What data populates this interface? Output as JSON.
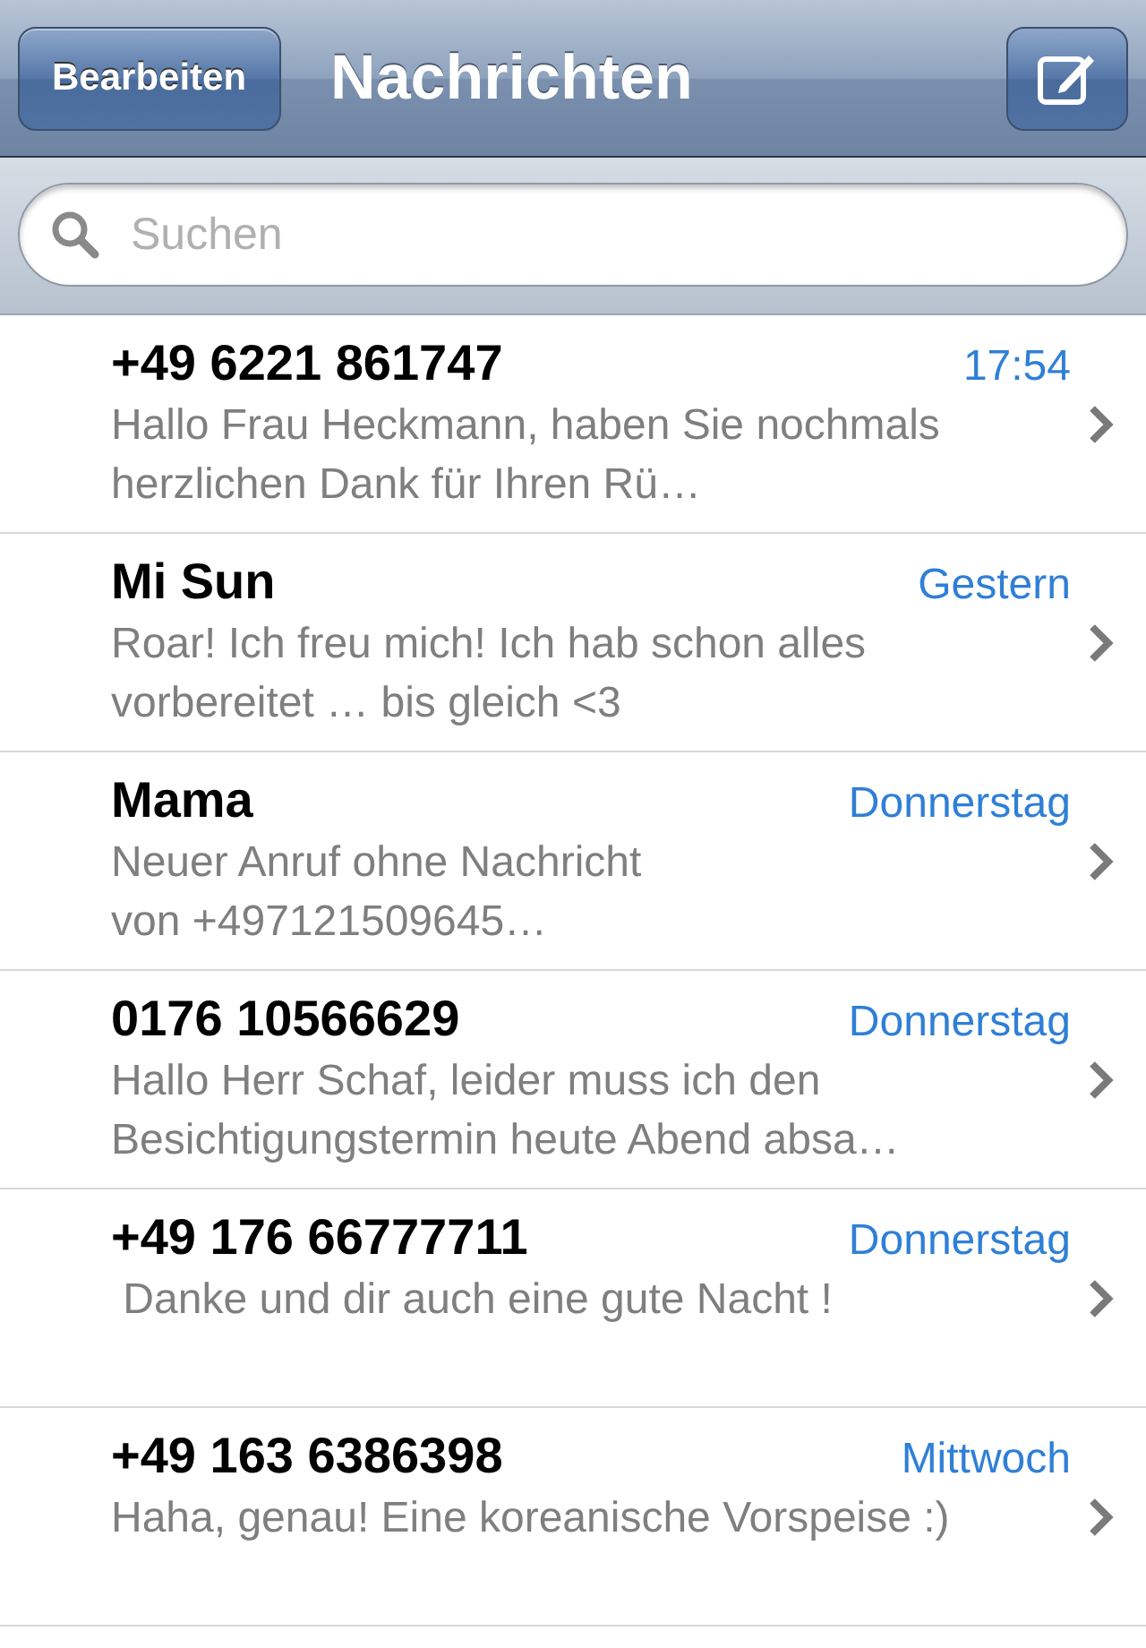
{
  "navbar": {
    "edit_button": "Bearbeiten",
    "title": "Nachrichten"
  },
  "search": {
    "placeholder": "Suchen"
  },
  "conversations": [
    {
      "name": "+49 6221 861747",
      "time": "17:54",
      "preview": "Hallo Frau Heckmann, haben Sie nochmals herzlichen Dank für Ihren Rü…"
    },
    {
      "name": "Mi Sun",
      "time": "Gestern",
      "preview": "Roar! Ich freu mich! Ich hab schon alles vorbereitet … bis gleich <3"
    },
    {
      "name": "Mama",
      "time": "Donnerstag",
      "preview": "Neuer Anruf ohne Nachricht\nvon +497121509645…"
    },
    {
      "name": "0176 10566629",
      "time": "Donnerstag",
      "preview": "Hallo Herr Schaf, leider muss ich den Besichtigungstermin heute Abend absa…"
    },
    {
      "name": "+49 176 66777711",
      "time": "Donnerstag",
      "preview": " Danke und dir auch eine gute Nacht !"
    },
    {
      "name": "+49 163 6386398",
      "time": "Mittwoch",
      "preview": "Haha, genau! Eine koreanische Vorspeise :)"
    }
  ]
}
